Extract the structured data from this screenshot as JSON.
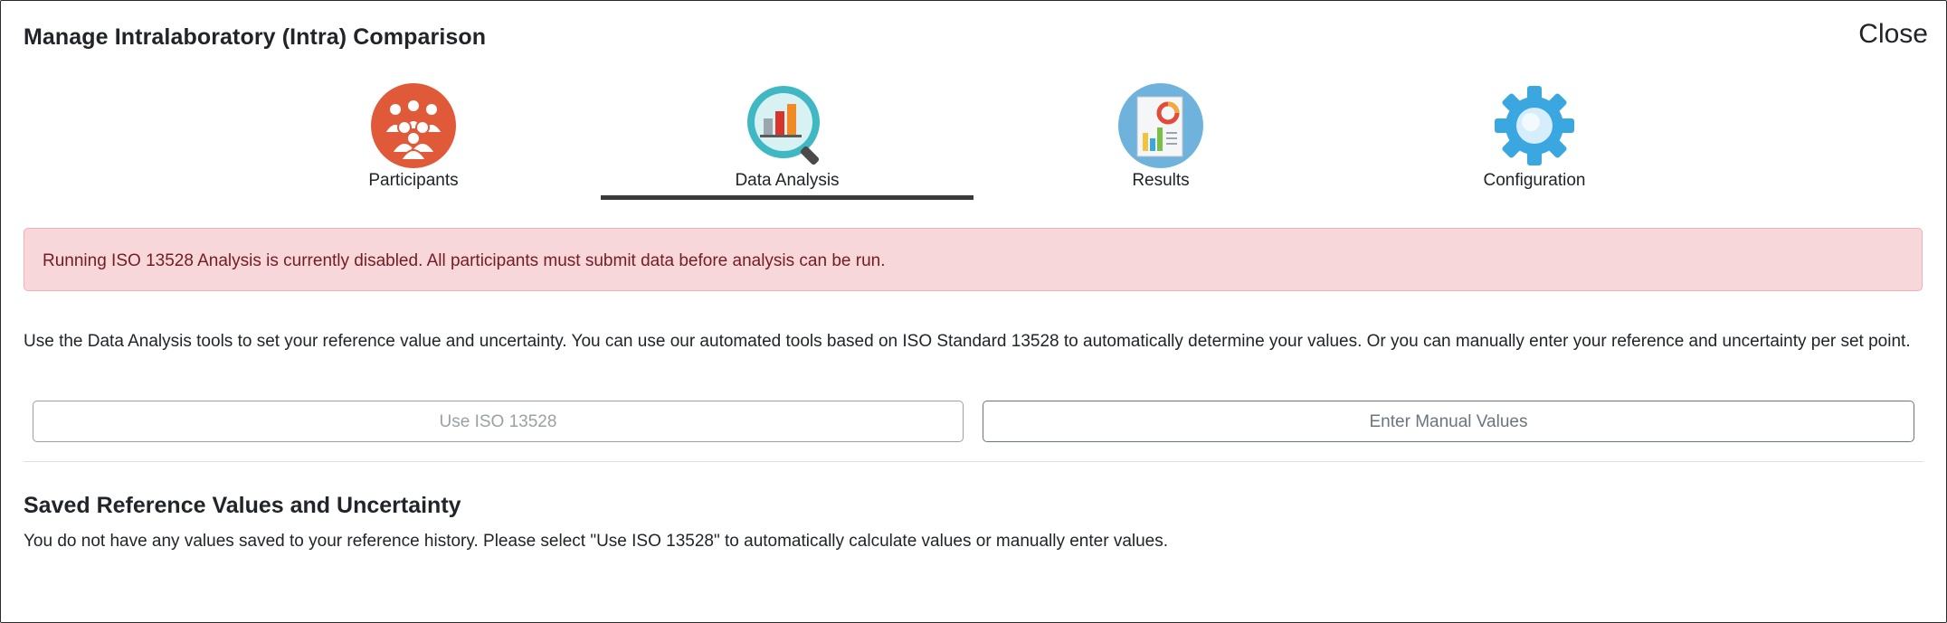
{
  "modal": {
    "title": "Manage Intralaboratory (Intra) Comparison",
    "close_label": "Close"
  },
  "tabs": [
    {
      "label": "Participants",
      "icon": "participants-icon",
      "active": false
    },
    {
      "label": "Data Analysis",
      "icon": "data-analysis-icon",
      "active": true
    },
    {
      "label": "Results",
      "icon": "results-icon",
      "active": false
    },
    {
      "label": "Configuration",
      "icon": "gear-icon",
      "active": false
    }
  ],
  "alert": {
    "text": "Running ISO 13528 Analysis is currently disabled. All participants must submit data before analysis can be run.",
    "color": "#f8d7da"
  },
  "intro_text": "Use the Data Analysis tools to set your reference value and uncertainty. You can use our automated tools based on ISO Standard 13528 to automatically determine your values. Or you can manually enter your reference and uncertainty per set point.",
  "buttons": {
    "iso_label": "Use ISO 13528",
    "iso_disabled": true,
    "manual_label": "Enter Manual Values"
  },
  "saved": {
    "heading": "Saved Reference Values and Uncertainty",
    "empty_text": "You do not have any values saved to your reference history. Please select \"Use ISO 13528\" to automatically calculate values or manually enter values."
  },
  "colors": {
    "participants": "#e05a3a",
    "data_analysis": "#3fb8c4",
    "results": "#6fb3dd",
    "configuration": "#3aa7e0"
  }
}
